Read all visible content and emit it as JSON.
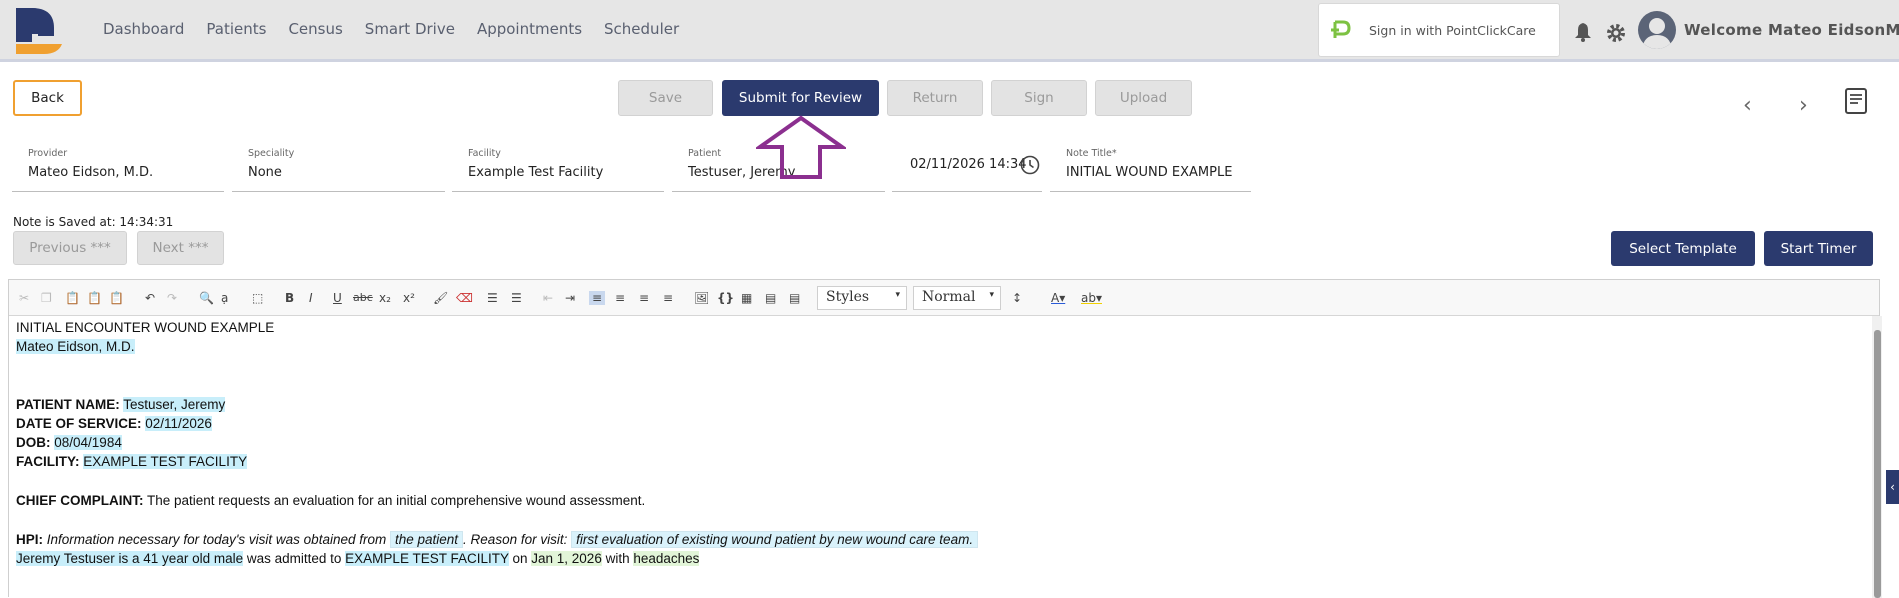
{
  "nav": {
    "items": [
      "Dashboard",
      "Patients",
      "Census",
      "Smart Drive",
      "Appointments",
      "Scheduler"
    ]
  },
  "header": {
    "pcc_label": "Sign in with PointClickCare",
    "welcome": "Welcome Mateo EidsonMA"
  },
  "actions": {
    "back": "Back",
    "save": "Save",
    "submit": "Submit for Review",
    "return": "Return",
    "sign": "Sign",
    "upload": "Upload"
  },
  "fields": {
    "provider": {
      "label": "Provider",
      "value": "Mateo Eidson, M.D."
    },
    "speciality": {
      "label": "Speciality",
      "value": "None"
    },
    "facility": {
      "label": "Facility",
      "value": "Example Test Facility"
    },
    "patient": {
      "label": "Patient",
      "value": "Testuser, Jeremy"
    },
    "datetime": {
      "value": "02/11/2026 14:34"
    },
    "note_title": {
      "label": "Note Title*",
      "value": "INITIAL WOUND EXAMPLE"
    }
  },
  "status": {
    "saved": "Note is Saved at: 14:34:31"
  },
  "nav_buttons": {
    "previous": "Previous ***",
    "next": "Next ***"
  },
  "template": {
    "select": "Select Template",
    "timer": "Start Timer"
  },
  "toolbar": {
    "styles": "Styles",
    "format": "Normal"
  },
  "note": {
    "title": "INITIAL ENCOUNTER WOUND EXAMPLE",
    "provider": "Mateo Eidson, M.D.",
    "patient_name_label": "PATIENT NAME:",
    "patient_name": "Testuser, Jeremy",
    "dos_label": "DATE OF SERVICE:",
    "dos": "02/11/2026",
    "dob_label": "DOB:",
    "dob": "08/04/1984",
    "facility_label": "FACILITY:",
    "facility": "EXAMPLE TEST FACILITY",
    "cc_label": "CHIEF COMPLAINT:",
    "cc": " The patient requests an evaluation for an initial comprehensive wound assessment.",
    "hpi_label": "HPI:",
    "hpi_text1": " Information necessary for today's visit was obtained from ",
    "hpi_source": "the patient",
    "hpi_text2": ". Reason for visit: ",
    "hpi_reason": "first evaluation of existing wound patient by new wound care team.",
    "line2_name": "Jeremy Testuser is a 41 year old male",
    "line2_mid": " was admitted to ",
    "line2_facility": "EXAMPLE TEST FACILITY",
    "line2_on": " on ",
    "line2_date": "Jan 1, 2026",
    "line2_with": " with ",
    "line2_reason": "headaches"
  },
  "colors": {
    "primary": "#2b3a6e",
    "back_border": "#f0a030",
    "highlight": "#c8eefa",
    "arrow": "#8b2f8f",
    "logo_blue": "#2b3a6e",
    "logo_orange": "#f0a030"
  }
}
